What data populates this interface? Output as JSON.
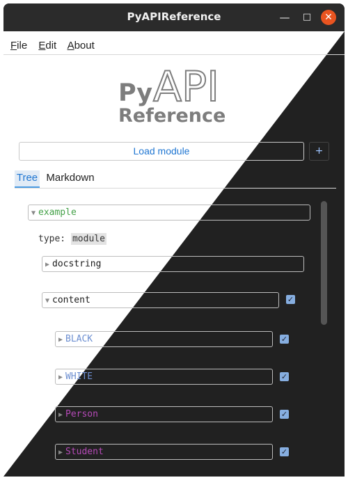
{
  "window": {
    "title": "PyAPIReference",
    "controls": {
      "minimize": "—",
      "maximize": "□",
      "close": "✕"
    }
  },
  "menu": {
    "items": [
      {
        "first": "F",
        "rest": "ile"
      },
      {
        "first": "E",
        "rest": "dit"
      },
      {
        "first": "A",
        "rest": "bout"
      }
    ]
  },
  "logo": {
    "py": "Py",
    "api": "API",
    "ref": "Reference"
  },
  "toolbar": {
    "load_label": "Load module",
    "plus_label": "+"
  },
  "tabs": [
    {
      "label": "Tree",
      "active": true
    },
    {
      "label": "Markdown",
      "active": false
    }
  ],
  "tree": {
    "root": {
      "label": "example",
      "arrow": "▼"
    },
    "type_key": "type:",
    "type_value": "module",
    "docstring": {
      "label": "docstring",
      "arrow": "▶"
    },
    "content": {
      "label": "content",
      "arrow": "▼",
      "checked": true
    },
    "items": [
      {
        "label": "BLACK",
        "arrow": "▶",
        "checked": true
      },
      {
        "label": "WHITE",
        "arrow": "▶",
        "checked": true
      },
      {
        "label": "Person",
        "arrow": "▶",
        "checked": true
      },
      {
        "label": "Student",
        "arrow": "▶",
        "checked": true
      }
    ]
  },
  "colors": {
    "accent": "#1f76d2",
    "close_button": "#e95420",
    "module_green": "#43a047",
    "constant_blue": "#6d8fd1",
    "class_magenta": "#b64ab8",
    "checkbox": "#86aee0"
  },
  "check_glyph": "✓"
}
